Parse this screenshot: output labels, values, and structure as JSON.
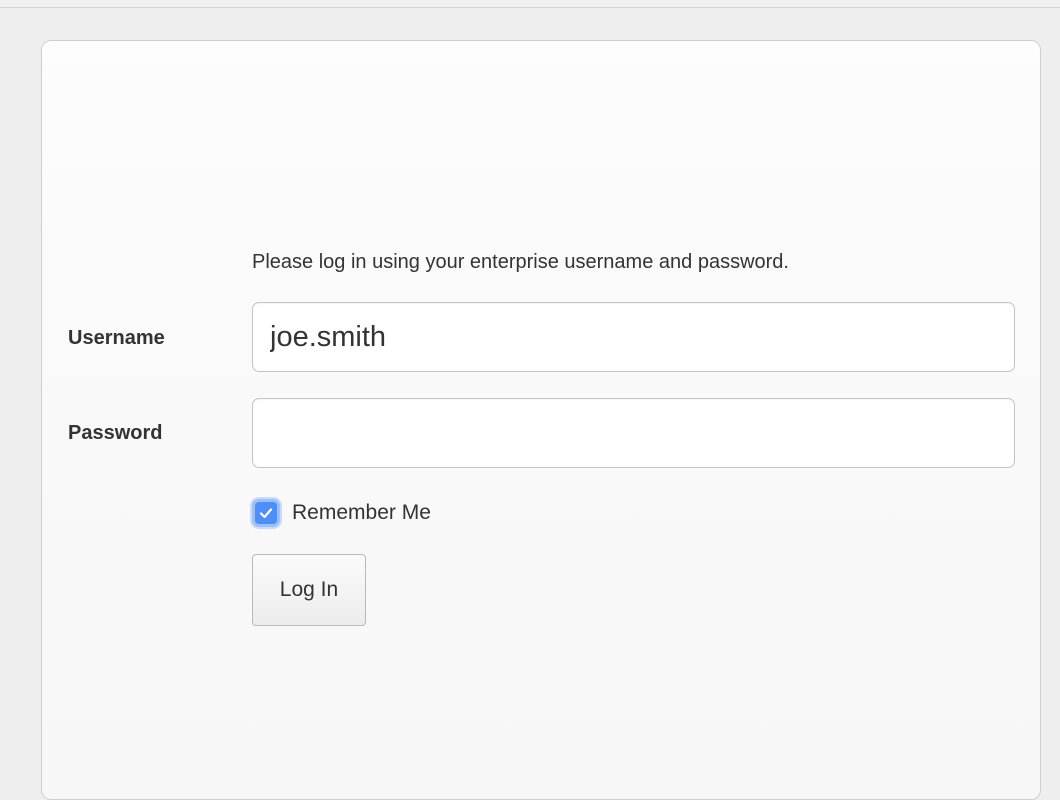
{
  "login_form": {
    "instructions": "Please log in using your enterprise username and password.",
    "username_label": "Username",
    "username_value": "joe.smith",
    "password_label": "Password",
    "password_value": "",
    "remember_label": "Remember Me",
    "remember_checked": true,
    "login_button_label": "Log In"
  },
  "icons": {
    "checkbox_mark": "checkmark-icon"
  },
  "colors": {
    "checkbox_accent": "#4d8ef7",
    "text": "#333333",
    "page_background": "#eeeeee"
  }
}
